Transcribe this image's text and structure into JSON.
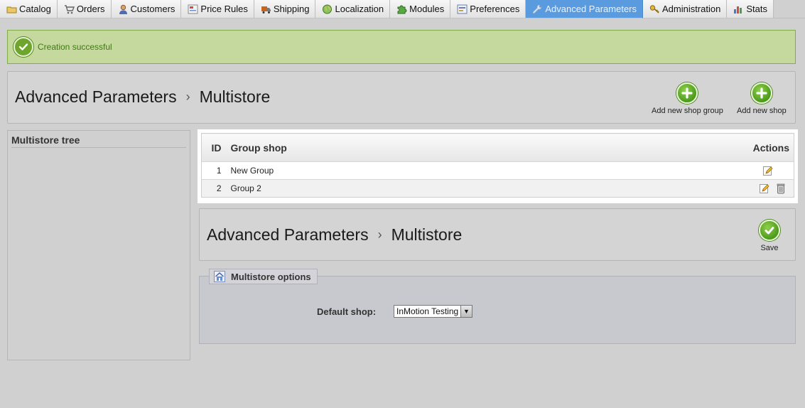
{
  "tabs": [
    {
      "label": "Catalog",
      "icon": "folder-icon"
    },
    {
      "label": "Orders",
      "icon": "cart-icon"
    },
    {
      "label": "Customers",
      "icon": "customer-icon"
    },
    {
      "label": "Price Rules",
      "icon": "price-tag-icon"
    },
    {
      "label": "Shipping",
      "icon": "truck-icon"
    },
    {
      "label": "Localization",
      "icon": "globe-icon"
    },
    {
      "label": "Modules",
      "icon": "puzzle-icon"
    },
    {
      "label": "Preferences",
      "icon": "preferences-icon"
    },
    {
      "label": "Advanced Parameters",
      "icon": "wrench-icon",
      "active": true
    },
    {
      "label": "Administration",
      "icon": "key-icon"
    },
    {
      "label": "Stats",
      "icon": "bar-chart-icon"
    }
  ],
  "confirmation": {
    "message": "Creation successful",
    "color": "#3f7a15"
  },
  "header": {
    "section": "Advanced Parameters",
    "page": "Multistore",
    "add_group_label": "Add new shop group",
    "add_shop_label": "Add new shop"
  },
  "tree": {
    "title": "Multistore tree"
  },
  "table": {
    "columns": {
      "id": "ID",
      "name": "Group shop",
      "actions": "Actions"
    },
    "rows": [
      {
        "id": "1",
        "name": "New Group",
        "actions": [
          "edit-icon"
        ]
      },
      {
        "id": "2",
        "name": "Group 2",
        "actions": [
          "edit-icon",
          "delete-icon"
        ]
      }
    ]
  },
  "form_header": {
    "section": "Advanced Parameters",
    "page": "Multistore",
    "save_label": "Save"
  },
  "options": {
    "legend": "Multistore options",
    "default_shop_label": "Default shop:",
    "default_shop_value": "InMotion Testing"
  },
  "colors": {
    "active_tab": "#5a9be0",
    "success_bg": "#c5d89e",
    "success_border": "#7fae44",
    "green_button": "#4c9a1c"
  }
}
